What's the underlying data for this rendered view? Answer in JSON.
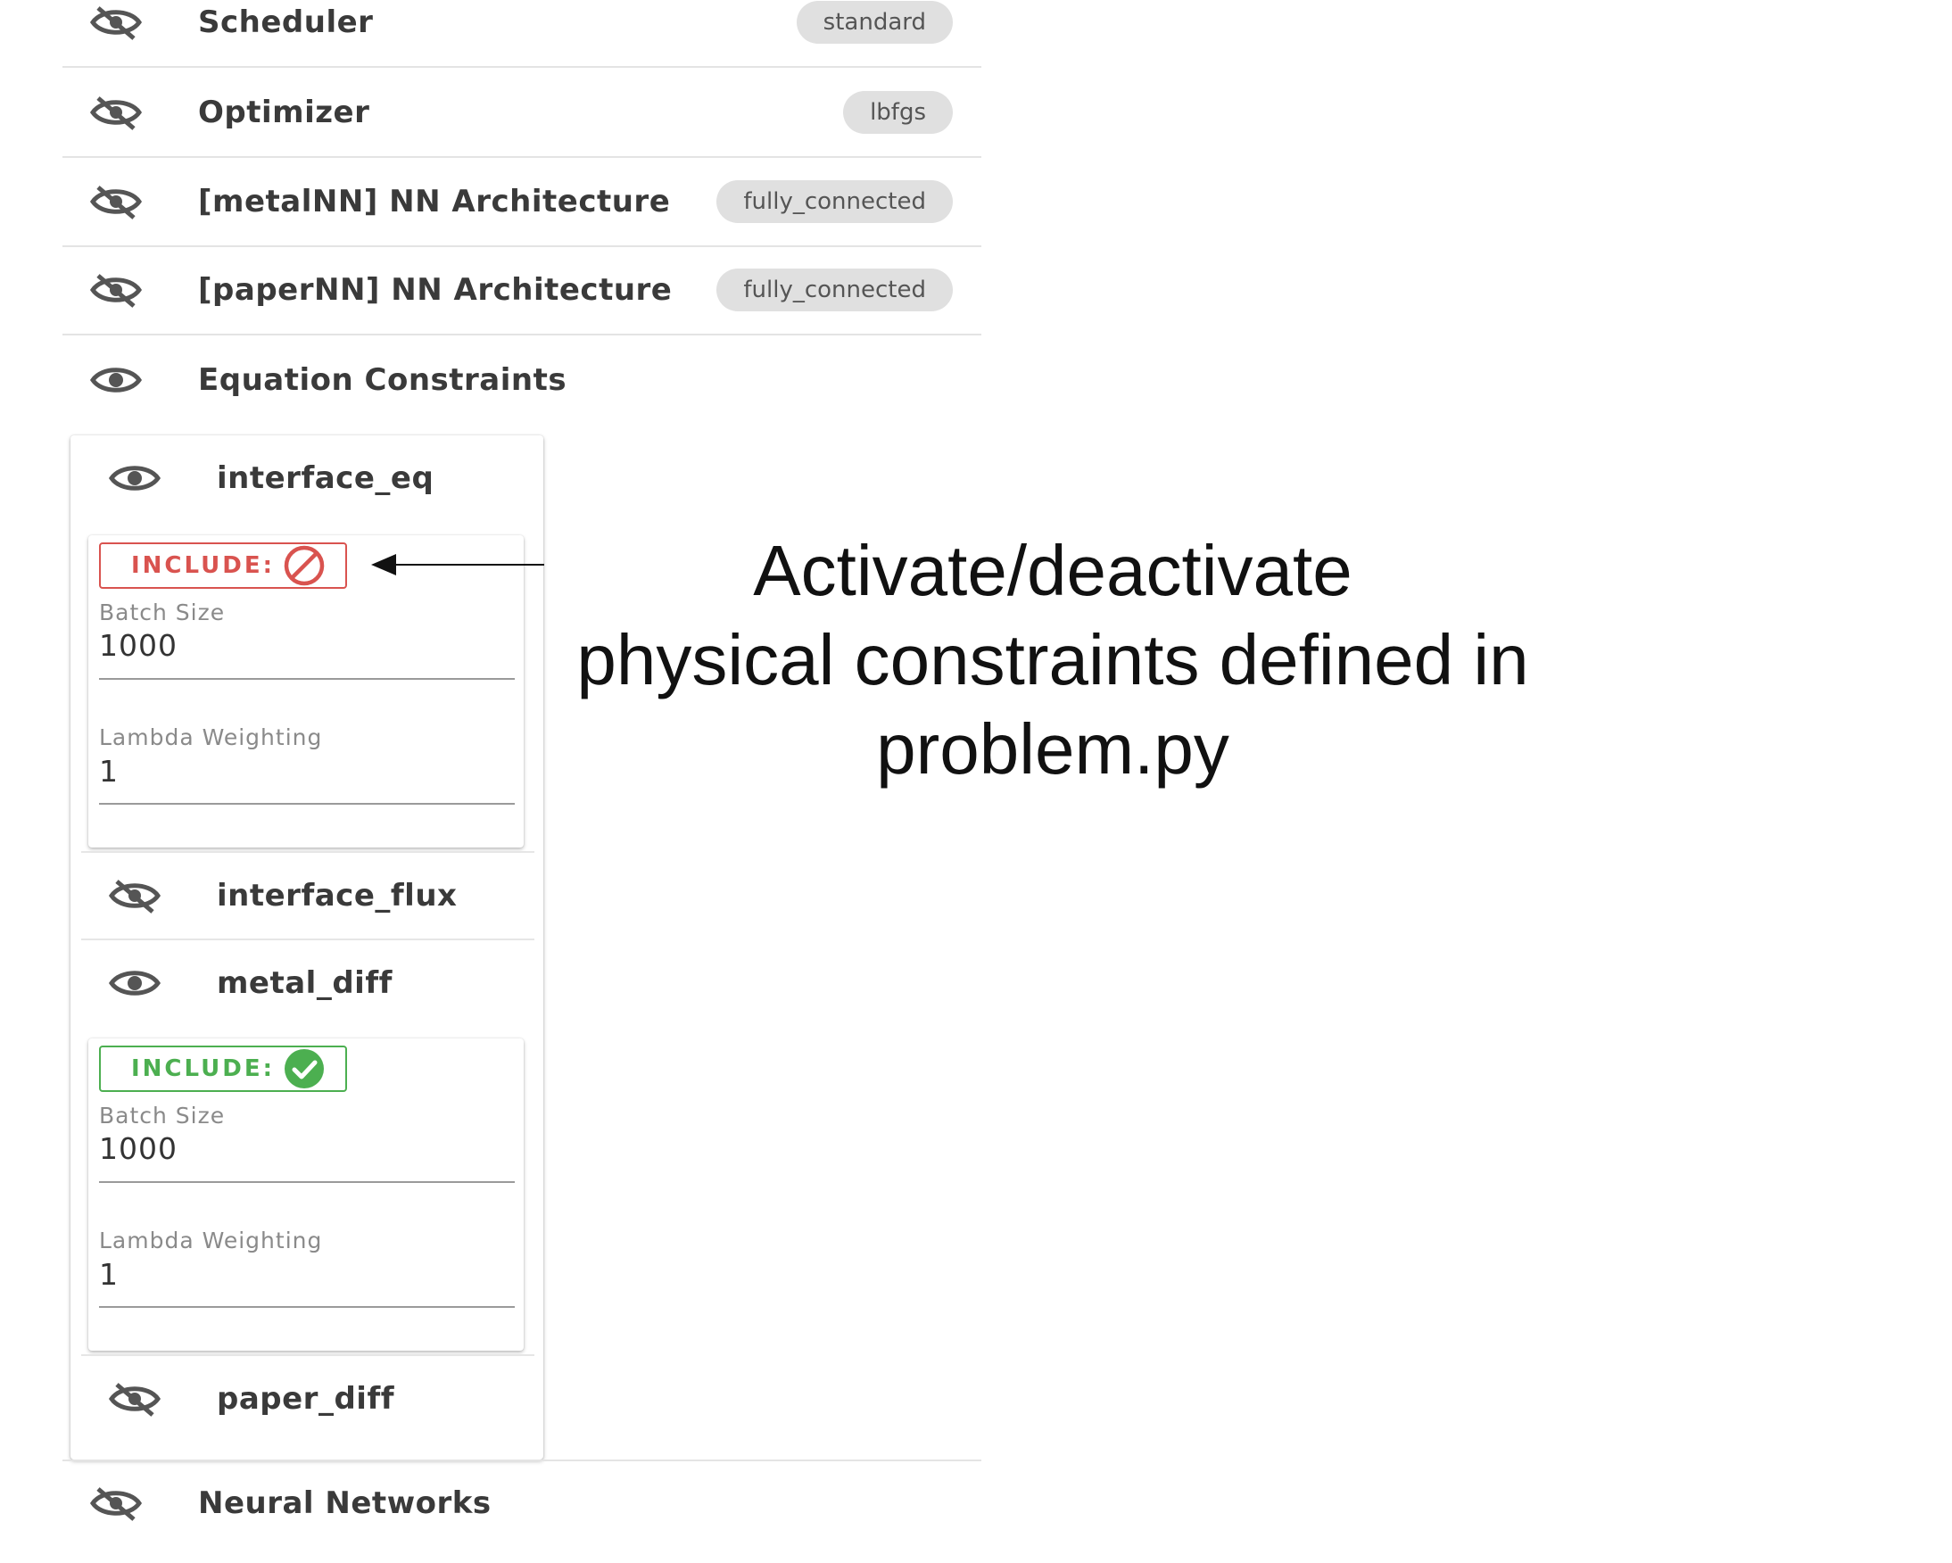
{
  "sections": [
    {
      "title": "Scheduler",
      "chip": "standard",
      "visible": false
    },
    {
      "title": "Optimizer",
      "chip": "lbfgs",
      "visible": false
    },
    {
      "title": "[metalNN] NN Architecture",
      "chip": "fully_connected",
      "visible": false
    },
    {
      "title": "[paperNN] NN Architecture",
      "chip": "fully_connected",
      "visible": false
    },
    {
      "title": "Equation Constraints",
      "chip": "",
      "visible": true
    },
    {
      "title": "Neural Networks",
      "chip": "",
      "visible": false
    }
  ],
  "constraints": [
    {
      "name": "interface_eq",
      "visible": true,
      "include_label": "INCLUDE:",
      "include_state": "excluded",
      "batch_size_label": "Batch Size",
      "batch_size": "1000",
      "lambda_label": "Lambda Weighting",
      "lambda": "1"
    },
    {
      "name": "interface_flux",
      "visible": false
    },
    {
      "name": "metal_diff",
      "visible": true,
      "include_label": "INCLUDE:",
      "include_state": "included",
      "batch_size_label": "Batch Size",
      "batch_size": "1000",
      "lambda_label": "Lambda Weighting",
      "lambda": "1"
    },
    {
      "name": "paper_diff",
      "visible": false
    }
  ],
  "annotation": {
    "line1": "Activate/deactivate",
    "line2": "physical constraints defined in",
    "line3": "problem.py"
  },
  "colors": {
    "exclude": "#d9534f",
    "include": "#4caf50",
    "chip_bg": "#e0e0e0",
    "icon": "#555555"
  },
  "icons": {
    "visible": "eye-icon",
    "hidden": "eye-off-icon",
    "excluded": "block-icon",
    "included": "check-circle-icon"
  }
}
